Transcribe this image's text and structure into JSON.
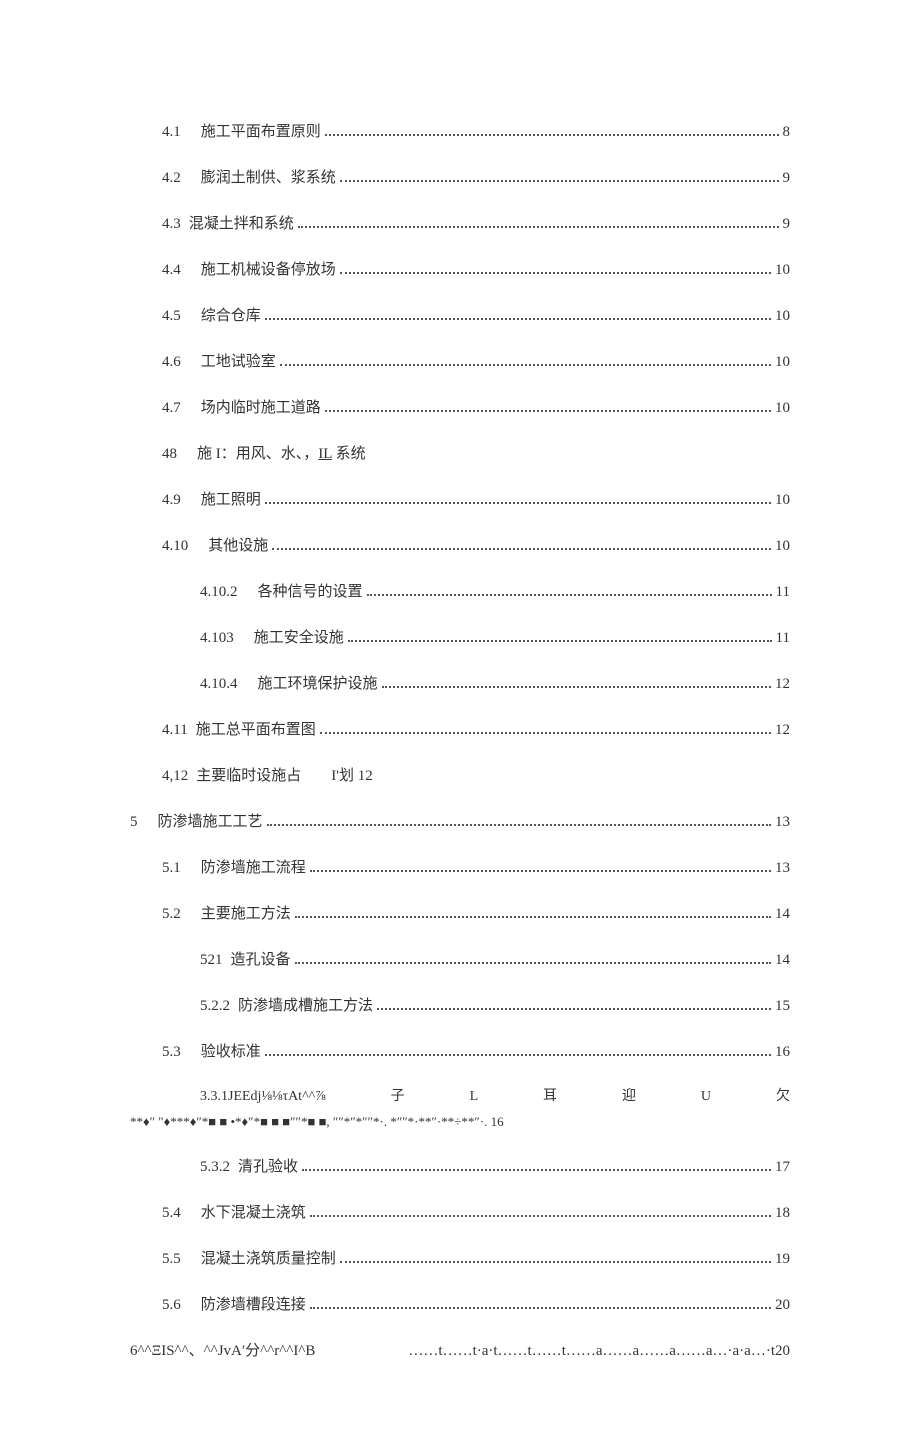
{
  "entries": [
    {
      "indent": 1,
      "num": "4.1",
      "title": "施工平面布置原则",
      "page": "8",
      "dots": true,
      "gap": true
    },
    {
      "indent": 1,
      "num": "4.2",
      "title": "膨润土制供、浆系统",
      "page": "9",
      "dots": true,
      "gap": true
    },
    {
      "indent": 1,
      "num": "4.3",
      "title": "混凝土拌和系统",
      "page": "9",
      "dots": true,
      "gap": false
    },
    {
      "indent": 1,
      "num": "4.4",
      "title": "施工机械设备停放场",
      "page": "10",
      "dots": true,
      "gap": true
    },
    {
      "indent": 1,
      "num": "4.5",
      "title": "综合仓库",
      "page": "10",
      "dots": true,
      "gap": true
    },
    {
      "indent": 1,
      "num": "4.6",
      "title": "工地试验室",
      "page": "10",
      "dots": true,
      "gap": true
    },
    {
      "indent": 1,
      "num": "4.7",
      "title": "场内临时施工道路",
      "page": "10",
      "dots": true,
      "gap": true
    },
    {
      "indent": 1,
      "num": "48",
      "title_html": "施 I：用风、水、，<span class='underline'>IL</span> 系统",
      "page": "",
      "dots": false,
      "gap": true
    },
    {
      "indent": 1,
      "num": "4.9",
      "title": "施工照明",
      "page": "10",
      "dots": true,
      "gap": true
    },
    {
      "indent": 1,
      "num": "4.10",
      "title": "其他设施",
      "page": "10",
      "dots": true,
      "gap": true
    },
    {
      "indent": 2,
      "num": "4.10.2",
      "title": "各种信号的设置",
      "page": "11",
      "dots": true,
      "gap": true
    },
    {
      "indent": 2,
      "num": "4.103",
      "title": "施工安全设施",
      "page": "11",
      "dots": true,
      "gap": true
    },
    {
      "indent": 2,
      "num": "4.10.4",
      "title": "施工环境保护设施",
      "page": "12",
      "dots": true,
      "gap": true
    },
    {
      "indent": 1,
      "num": "4.11",
      "title": "施工总平面布置图",
      "page": "12",
      "dots": true,
      "gap": false
    },
    {
      "indent": 1,
      "num": "4,12",
      "title": "主要临时设施占  I'划 12",
      "page": "",
      "dots": false,
      "gap": false
    },
    {
      "indent": 0,
      "num": "5",
      "title": "防渗墙施工工艺",
      "page": "13",
      "dots": true,
      "gap": true
    },
    {
      "indent": 1,
      "num": "5.1",
      "title": "防渗墙施工流程",
      "page": "13",
      "dots": true,
      "gap": true
    },
    {
      "indent": 1,
      "num": "5.2",
      "title": "主要施工方法",
      "page": "14",
      "dots": true,
      "gap": true
    },
    {
      "indent": 2,
      "num": "521",
      "title": "造孔设备",
      "page": "14",
      "dots": true,
      "gap": false
    },
    {
      "indent": 2,
      "num": "5.2.2",
      "title": "防渗墙成槽施工方法",
      "page": "15",
      "dots": true,
      "gap": false
    },
    {
      "indent": 1,
      "num": "5.3",
      "title": "验收标准",
      "page": "16",
      "dots": true,
      "gap": true
    }
  ],
  "garbled_row": {
    "num": "3.3.1JEEdj⅛⅛τAt^^⅞",
    "parts": [
      "子",
      "L",
      "耳",
      "迎",
      "U",
      "欠"
    ]
  },
  "garbled_sub": "**♦″ \"♦***♦″*■ ■ •*♦″*■ ■ ■″″*■ ■, ″″*″*″″*·. *″″*·**″·**÷**″·. 16",
  "entries2": [
    {
      "indent": 2,
      "num": "5.3.2",
      "title": "清孔验收",
      "page": "17",
      "dots": true,
      "gap": false
    },
    {
      "indent": 1,
      "num": "5.4",
      "title": "水下混凝土浇筑",
      "page": "18",
      "dots": true,
      "gap": true
    },
    {
      "indent": 1,
      "num": "5.5",
      "title": "混凝土浇筑质量控制",
      "page": "19",
      "dots": true,
      "gap": true
    },
    {
      "indent": 1,
      "num": "5.6",
      "title": "防渗墙槽段连接",
      "page": "20",
      "dots": true,
      "gap": true
    }
  ],
  "footer_line": {
    "left": "6^^ΞIS^^、^^JvA′分^^r^^I^B",
    "right": "……t……t·a·t……t……t……a……a……a……a…·a·a…·t20"
  }
}
